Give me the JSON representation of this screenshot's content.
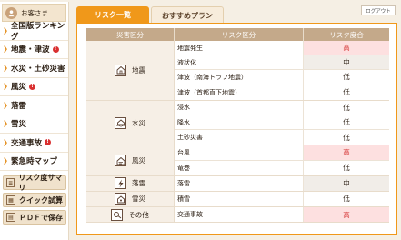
{
  "sidebar": {
    "user": "お客さま",
    "items": [
      {
        "label": "全国版ランキング",
        "badge": ""
      },
      {
        "label": "地震・津波",
        "badge": "!"
      },
      {
        "label": "水災・土砂災害",
        "badge": ""
      },
      {
        "label": "風災",
        "badge": "!"
      },
      {
        "label": "落雷",
        "badge": ""
      },
      {
        "label": "雪災",
        "badge": ""
      },
      {
        "label": "交通事故",
        "badge": "!"
      },
      {
        "label": "緊急時マップ",
        "badge": ""
      }
    ],
    "buttons": [
      {
        "label": "リスク度サマリ"
      },
      {
        "label": "クイック試算"
      },
      {
        "label": "ＰＤＦで保存"
      }
    ]
  },
  "header": {
    "logout": "ログアウト",
    "tabs": [
      "リスク一覧",
      "おすすめプラン"
    ]
  },
  "table": {
    "headers": [
      "災害区分",
      "リスク区分",
      "リスク度合"
    ],
    "groups": [
      {
        "category": "地震",
        "icon": "house-earthquake-icon",
        "rows": [
          {
            "name": "地震発生",
            "level": "高",
            "kind": "high"
          },
          {
            "name": "液状化",
            "level": "中",
            "kind": "mid"
          },
          {
            "name": "津波（南海トラフ地震）",
            "level": "低",
            "kind": "low"
          },
          {
            "name": "津波（首都直下地震）",
            "level": "低",
            "kind": "low"
          }
        ]
      },
      {
        "category": "水災",
        "icon": "house-flood-icon",
        "rows": [
          {
            "name": "浸水",
            "level": "低",
            "kind": "low"
          },
          {
            "name": "降水",
            "level": "低",
            "kind": "low"
          },
          {
            "name": "土砂災害",
            "level": "低",
            "kind": "low"
          }
        ]
      },
      {
        "category": "風災",
        "icon": "house-wind-icon",
        "rows": [
          {
            "name": "台風",
            "level": "高",
            "kind": "high"
          },
          {
            "name": "竜巻",
            "level": "低",
            "kind": "low"
          }
        ]
      },
      {
        "category": "落雷",
        "icon": "lightning-icon",
        "rows": [
          {
            "name": "落雷",
            "level": "中",
            "kind": "mid"
          }
        ]
      },
      {
        "category": "雪災",
        "icon": "snow-icon",
        "rows": [
          {
            "name": "積雪",
            "level": "低",
            "kind": "low"
          }
        ]
      },
      {
        "category": "その他",
        "icon": "other-icon",
        "rows": [
          {
            "name": "交通事故",
            "level": "高",
            "kind": "high"
          }
        ]
      }
    ]
  }
}
